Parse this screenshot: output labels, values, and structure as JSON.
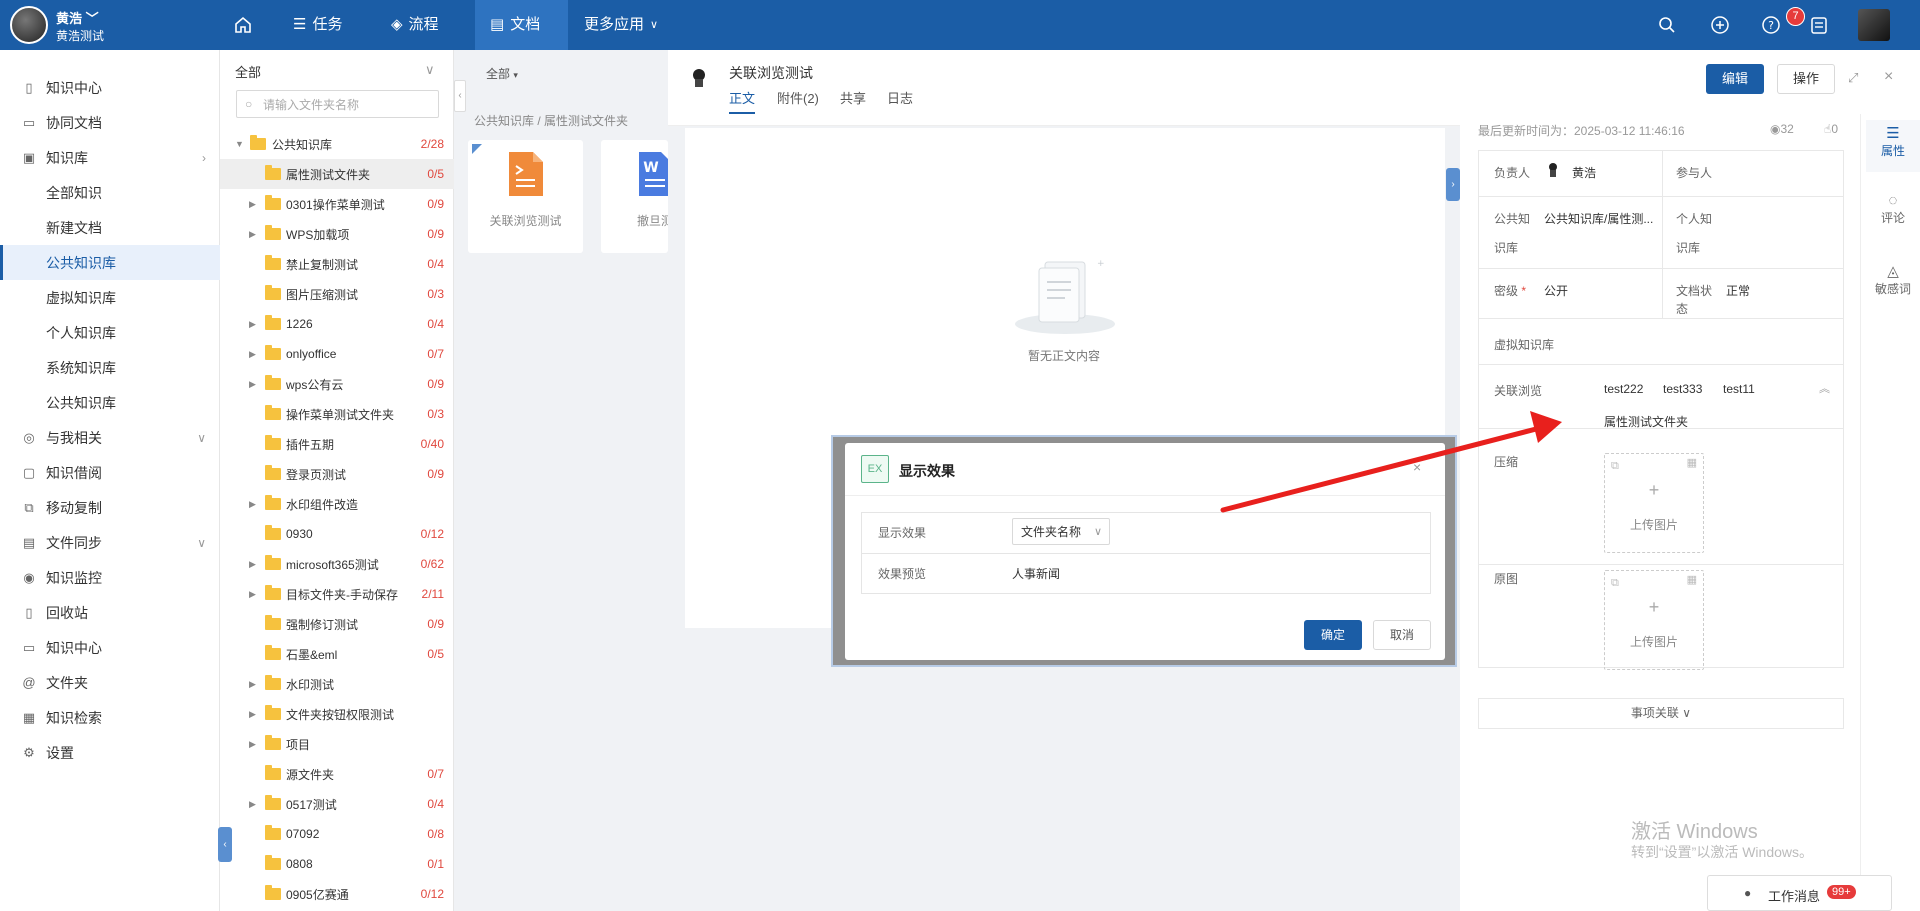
{
  "topbar": {
    "user_name": "黄浩",
    "org_name": "黄浩测试",
    "nav": [
      {
        "label": "任务",
        "icon": "list-icon"
      },
      {
        "label": "流程",
        "icon": "layers-icon"
      },
      {
        "label": "文档",
        "icon": "document-icon"
      },
      {
        "label": "更多应用",
        "icon": "chevron-down-icon"
      }
    ],
    "notification_count": "7",
    "colors": {
      "bar": "#1b5da6",
      "active": "#2e73c0",
      "badge": "#e63b3b"
    }
  },
  "leftnav": {
    "items": [
      {
        "label": "知识中心",
        "icon": "file-icon"
      },
      {
        "label": "协同文档",
        "icon": "collab-icon"
      },
      {
        "label": "知识库",
        "icon": "library-icon"
      },
      {
        "label": "全部知识"
      },
      {
        "label": "新建文档"
      },
      {
        "label": "公共知识库"
      },
      {
        "label": "虚拟知识库"
      },
      {
        "label": "个人知识库"
      },
      {
        "label": "系统知识库"
      },
      {
        "label": "公共知识库"
      },
      {
        "label": "与我相关",
        "icon": "related-icon"
      },
      {
        "label": "知识借阅",
        "icon": "borrow-icon"
      },
      {
        "label": "移动复制",
        "icon": "copy-icon"
      },
      {
        "label": "文件同步",
        "icon": "sync-icon"
      },
      {
        "label": "知识监控",
        "icon": "monitor-icon"
      },
      {
        "label": "回收站",
        "icon": "trash-icon"
      },
      {
        "label": "知识中心",
        "icon": "file-icon"
      },
      {
        "label": "文件夹",
        "icon": "at-icon"
      },
      {
        "label": "知识检索",
        "icon": "table-icon"
      },
      {
        "label": "设置",
        "icon": "gear-icon"
      }
    ]
  },
  "tree": {
    "header": "全部",
    "search_placeholder": "请输入文件夹名称",
    "root": {
      "label": "公共知识库",
      "count": "2/28"
    },
    "items": [
      {
        "label": "属性测试文件夹",
        "count": "0/5"
      },
      {
        "label": "0301操作菜单测试",
        "count": "0/9"
      },
      {
        "label": "WPS加载项",
        "count": "0/9"
      },
      {
        "label": "禁止复制测试",
        "count": "0/4"
      },
      {
        "label": "图片压缩测试",
        "count": "0/3"
      },
      {
        "label": "1226",
        "count": "0/4"
      },
      {
        "label": "onlyoffice",
        "count": "0/7"
      },
      {
        "label": "wps公有云",
        "count": "0/9"
      },
      {
        "label": "操作菜单测试文件夹",
        "count": "0/3"
      },
      {
        "label": "插件五期",
        "count": "0/40"
      },
      {
        "label": "登录页测试",
        "count": "0/9"
      },
      {
        "label": "水印组件改造",
        "count": ""
      },
      {
        "label": "0930",
        "count": "0/12"
      },
      {
        "label": "microsoft365测试",
        "count": "0/62"
      },
      {
        "label": "目标文件夹-手动保存",
        "count": "2/11"
      },
      {
        "label": "强制修订测试",
        "count": "0/9"
      },
      {
        "label": "石墨&eml",
        "count": "0/5"
      },
      {
        "label": "水印测试",
        "count": ""
      },
      {
        "label": "文件夹按钮权限测试",
        "count": ""
      },
      {
        "label": "项目",
        "count": ""
      },
      {
        "label": "源文件夹",
        "count": "0/7"
      },
      {
        "label": "0517测试",
        "count": "0/4"
      },
      {
        "label": "07092",
        "count": "0/8"
      },
      {
        "label": "0808",
        "count": "0/1"
      },
      {
        "label": "0905亿赛通",
        "count": "0/12"
      }
    ]
  },
  "files": {
    "filter": "全部",
    "breadcrumb": "公共知识库 / 属性测试文件夹",
    "cards": [
      {
        "name": "关联浏览测试"
      },
      {
        "name": "撤旦测"
      }
    ]
  },
  "detail": {
    "title": "关联浏览测试",
    "tabs": [
      "正文",
      "附件(2)",
      "共享",
      "日志"
    ],
    "edit": "编辑",
    "operate": "操作",
    "empty_text": "暂无正文内容",
    "updated": "最后更新时间为：2025-03-12 11:46:16",
    "views": "32",
    "likes": "0",
    "props": {
      "owner_label": "负责人",
      "owner_value": "黄浩",
      "participant_label": "参与人",
      "public_kb_label_1": "公共知",
      "public_kb_label_2": "识库",
      "public_kb_value": "公共知识库/属性测...",
      "personal_kb_label_1": "个人知",
      "personal_kb_label_2": "识库",
      "secret_label": "密级",
      "required_mark": "*",
      "secret_value": "公开",
      "doc_status_label_1": "文档状",
      "doc_status_label_2": "态",
      "doc_status_value": "正常",
      "virtual_kb_label": "虚拟知识库",
      "related_label": "关联浏览",
      "related_values": [
        "test222",
        "test333",
        "test11",
        "属性测试文件夹"
      ],
      "compress_label": "压缩",
      "original_label": "原图",
      "upload_label": "上传图片",
      "plus": "+",
      "matters_label": "事项关联"
    },
    "rail": [
      {
        "label": "属性",
        "icon": "sliders-icon"
      },
      {
        "label": "评论",
        "icon": "comment-icon"
      },
      {
        "label": "敏感词",
        "icon": "sensitive-icon"
      }
    ]
  },
  "modal": {
    "icon_text": "EX",
    "title": "显示效果",
    "close": "×",
    "row1_label": "显示效果",
    "row1_value": "文件夹名称",
    "row2_label": "效果预览",
    "row2_value": "人事新闻",
    "ok": "确定",
    "cancel": "取消"
  },
  "watermark": {
    "line1": "激活 Windows",
    "line2": "转到“设置”以激活 Windows。"
  },
  "worktray": {
    "label": "工作消息",
    "count": "99+"
  }
}
